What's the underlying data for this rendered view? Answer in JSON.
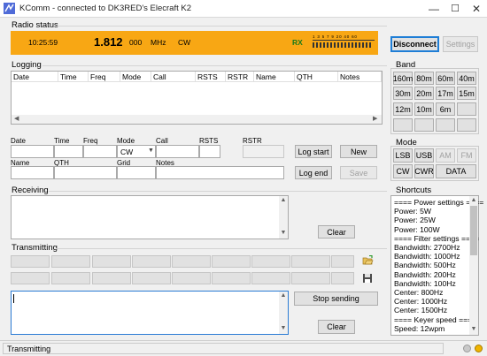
{
  "window": {
    "title": "KComm - connected to DK3RED's Elecraft K2",
    "minimize": "—",
    "maximize": "☐",
    "close": "✕"
  },
  "radio_status": {
    "label": "Radio status",
    "time": "10:25:59",
    "freq_main": "1.812",
    "freq_sub": "000",
    "freq_unit": "MHz",
    "mode": "CW",
    "rx": "RX",
    "smeter_scale": "1 3 5 7 9 20 40 60",
    "disconnect": "Disconnect",
    "settings": "Settings",
    "color_accent": "#f8a714"
  },
  "logging": {
    "label": "Logging",
    "columns": [
      "Date",
      "Time",
      "Freq",
      "Mode",
      "Call",
      "RSTS",
      "RSTR",
      "Name",
      "QTH",
      "Notes"
    ],
    "fields": {
      "date": "Date",
      "time": "Time",
      "freq": "Freq",
      "mode": "Mode",
      "call": "Call",
      "rsts": "RSTS",
      "rstr": "RSTR",
      "name": "Name",
      "qth": "QTH",
      "grid": "Grid",
      "notes": "Notes"
    },
    "mode_value": "CW",
    "log_start": "Log start",
    "new": "New",
    "log_end": "Log end",
    "save": "Save"
  },
  "receiving": {
    "label": "Receiving",
    "clear": "Clear"
  },
  "transmitting": {
    "label": "Transmitting",
    "stop": "Stop sending",
    "clear": "Clear"
  },
  "band": {
    "label": "Band",
    "buttons": [
      "160m",
      "80m",
      "60m",
      "40m",
      "30m",
      "20m",
      "17m",
      "15m",
      "12m",
      "10m",
      "6m",
      "",
      "",
      "",
      "",
      ""
    ]
  },
  "mode": {
    "label": "Mode",
    "buttons": [
      "LSB",
      "USB",
      "AM",
      "FM",
      "CW",
      "CWR",
      "DATA"
    ]
  },
  "shortcuts": {
    "label": "Shortcuts",
    "items": [
      "==== Power settings ====",
      "Power: 5W",
      "Power: 25W",
      "Power: 100W",
      "==== Filter settings ====",
      "Bandwidth: 2700Hz",
      "Bandwidth: 1000Hz",
      "Bandwidth: 500Hz",
      "Bandwidth: 200Hz",
      "Bandwidth: 100Hz",
      "Center: 800Hz",
      "Center: 1000Hz",
      "Center: 1500Hz",
      "==== Keyer speed ====",
      "Speed: 12wpm"
    ]
  },
  "status": {
    "text": "Transmitting"
  }
}
